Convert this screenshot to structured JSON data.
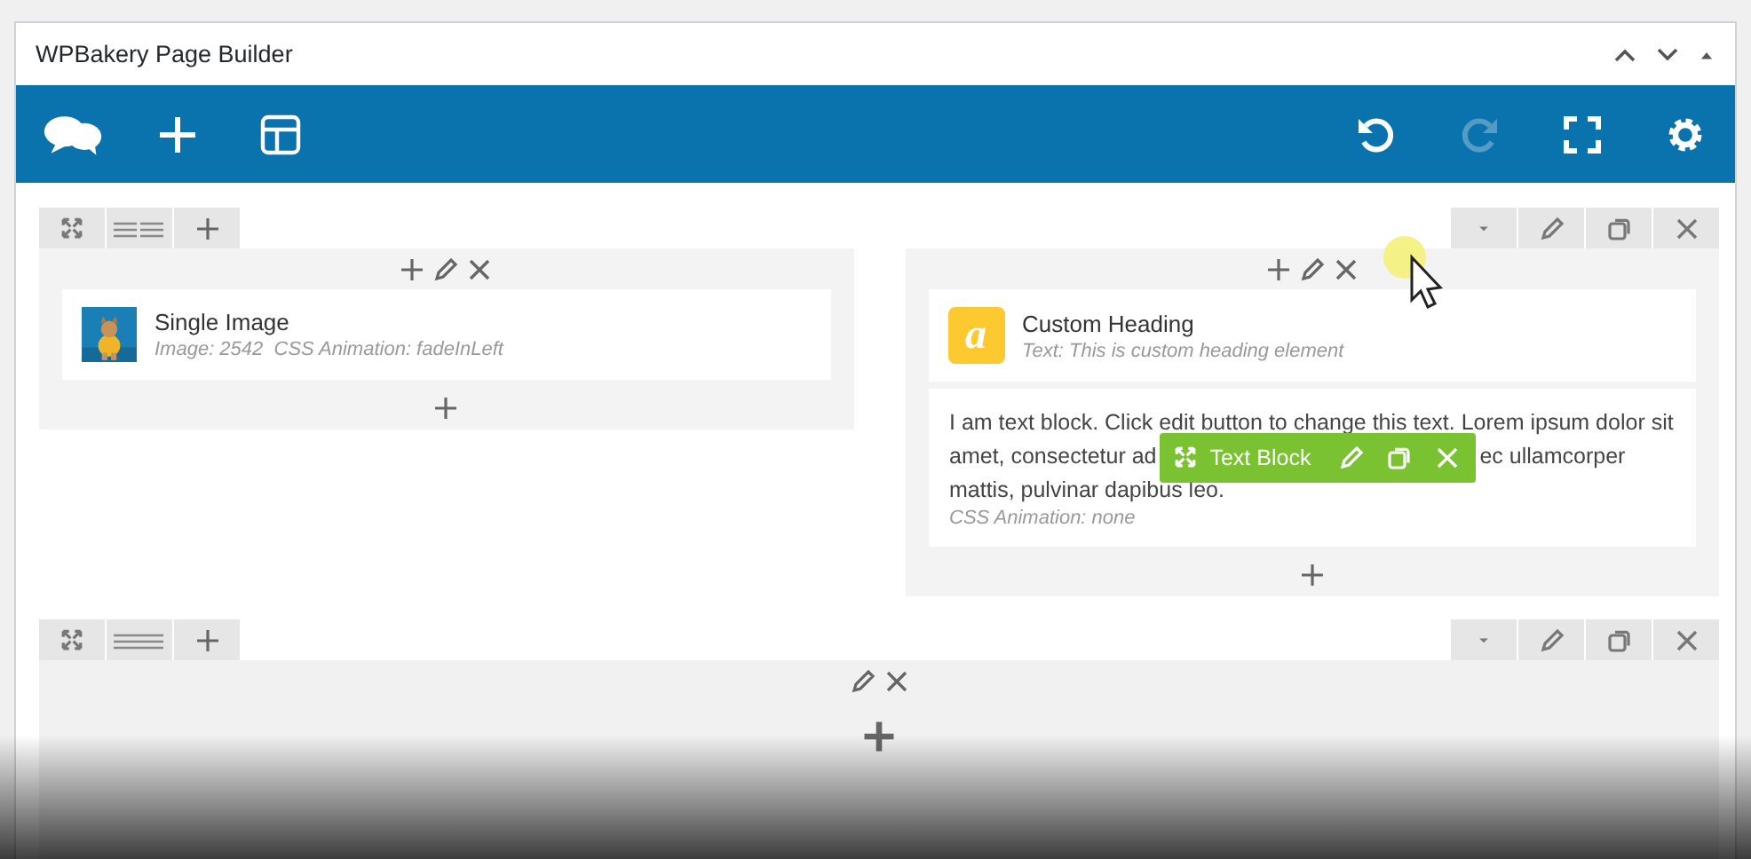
{
  "window": {
    "title": "WPBakery Page Builder"
  },
  "toolbar": {
    "undo": {
      "disabled": false
    },
    "redo": {
      "disabled": true
    }
  },
  "rows": [
    {
      "columns": [
        {
          "elements": [
            {
              "title": "Single Image",
              "details": "Image: 2542  CSS Animation: fadeInLeft"
            }
          ]
        },
        {
          "elements": [
            {
              "kind": "heading",
              "badge": "a",
              "title": "Custom Heading",
              "details": "Text: This is custom heading element"
            },
            {
              "kind": "text",
              "lines": [
                "I am text block. Click edit button to change this text. Lorem ipsum dolor sit"
              ],
              "before_toolbar": "amet, consectetur ad",
              "after_toolbar": "ec ullamcorper",
              "last_line": "mattis, pulvinar dapibus leo.",
              "details": "CSS Animation: none",
              "toolbar_label": "Text Block"
            }
          ]
        }
      ]
    },
    {
      "columns": [
        {}
      ]
    }
  ]
}
